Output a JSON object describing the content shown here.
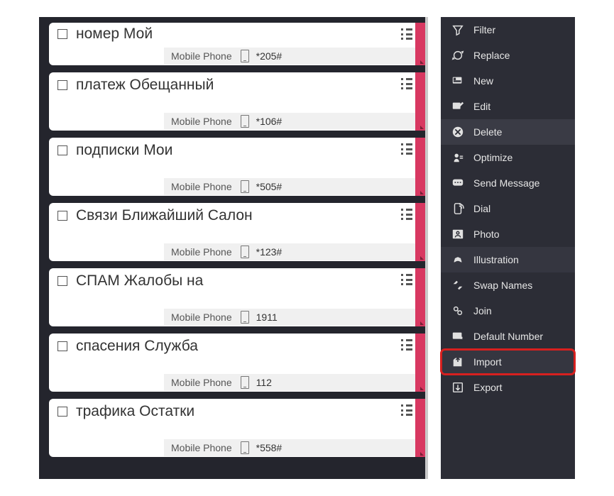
{
  "contacts": [
    {
      "name": "номер Мой",
      "type": "Mobile Phone",
      "number": "*205#"
    },
    {
      "name": "платеж Обещанный",
      "type": "Mobile Phone",
      "number": "*106#"
    },
    {
      "name": "подписки Мои",
      "type": "Mobile Phone",
      "number": "*505#"
    },
    {
      "name": "Связи Ближайший Салон",
      "type": "Mobile Phone",
      "number": "*123#"
    },
    {
      "name": "СПАМ Жалобы на",
      "type": "Mobile Phone",
      "number": "1911"
    },
    {
      "name": "спасения Служба",
      "type": "Mobile Phone",
      "number": "112"
    },
    {
      "name": "трафика Остатки",
      "type": "Mobile Phone",
      "number": "*558#"
    }
  ],
  "menu": {
    "filter": "Filter",
    "replace": "Replace",
    "new": "New",
    "edit": "Edit",
    "delete": "Delete",
    "optimize": "Optimize",
    "send_message": "Send Message",
    "dial": "Dial",
    "photo": "Photo",
    "illustration": "Illustration",
    "swap_names": "Swap Names",
    "join": "Join",
    "default_number": "Default Number",
    "import": "Import",
    "export": "Export"
  }
}
